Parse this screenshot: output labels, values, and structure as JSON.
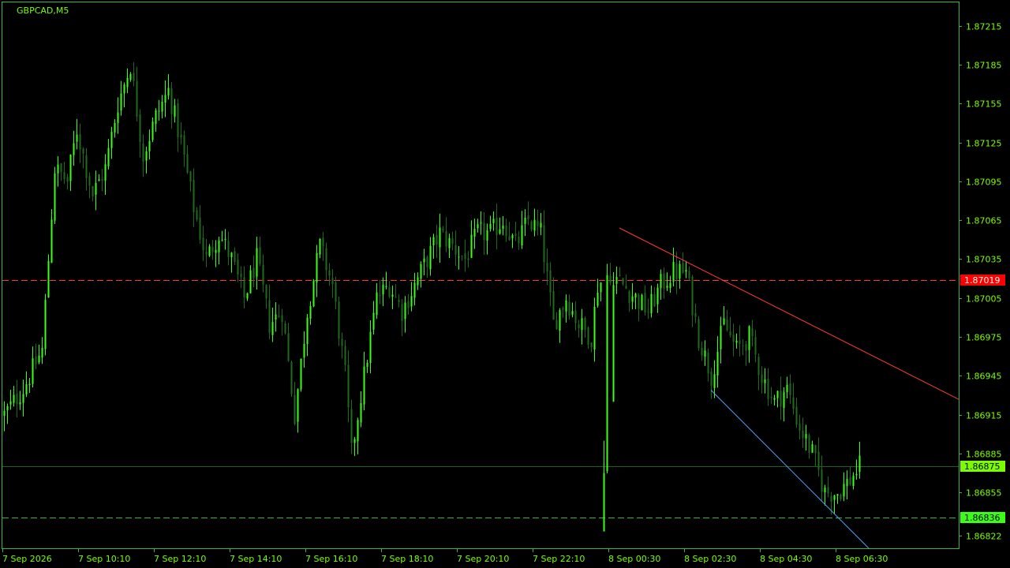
{
  "window": {
    "symbol_label": "GBPCAD,M5"
  },
  "chart_data": {
    "type": "candlestick",
    "symbol": "GBPCAD",
    "timeframe": "M5",
    "ylim": [
      1.86812,
      1.87233
    ],
    "y_ticks": [
      "1.87215",
      "1.87185",
      "1.87155",
      "1.87125",
      "1.87095",
      "1.87065",
      "1.87035",
      "1.87005",
      "1.86975",
      "1.86945",
      "1.86915",
      "1.86885",
      "1.86855",
      "1.86822"
    ],
    "x_ticks": [
      {
        "bar": 0,
        "label": "7 Sep 2026"
      },
      {
        "bar": 24,
        "label": "7 Sep 10:10"
      },
      {
        "bar": 48,
        "label": "7 Sep 12:10"
      },
      {
        "bar": 72,
        "label": "7 Sep 14:10"
      },
      {
        "bar": 96,
        "label": "7 Sep 16:10"
      },
      {
        "bar": 120,
        "label": "7 Sep 18:10"
      },
      {
        "bar": 144,
        "label": "7 Sep 20:10"
      },
      {
        "bar": 168,
        "label": "7 Sep 22:10"
      },
      {
        "bar": 192,
        "label": "8 Sep 00:30"
      },
      {
        "bar": 216,
        "label": "8 Sep 02:30"
      },
      {
        "bar": 240,
        "label": "8 Sep 04:30"
      },
      {
        "bar": 264,
        "label": "8 Sep 06:30"
      }
    ],
    "bar_count": 272,
    "close_anchors": [
      [
        0,
        1.86915
      ],
      [
        6,
        1.86935
      ],
      [
        12,
        1.86965
      ],
      [
        14,
        1.87035
      ],
      [
        16,
        1.87105
      ],
      [
        20,
        1.87095
      ],
      [
        23,
        1.87135
      ],
      [
        28,
        1.87085
      ],
      [
        32,
        1.87105
      ],
      [
        36,
        1.87155
      ],
      [
        40,
        1.87185
      ],
      [
        44,
        1.87115
      ],
      [
        48,
        1.87145
      ],
      [
        52,
        1.87165
      ],
      [
        56,
        1.87125
      ],
      [
        60,
        1.87075
      ],
      [
        64,
        1.87035
      ],
      [
        68,
        1.87055
      ],
      [
        72,
        1.87035
      ],
      [
        76,
        1.87005
      ],
      [
        80,
        1.87035
      ],
      [
        84,
        1.86985
      ],
      [
        88,
        1.86995
      ],
      [
        92,
        1.86915
      ],
      [
        96,
        1.86995
      ],
      [
        100,
        1.87045
      ],
      [
        104,
        1.87015
      ],
      [
        108,
        1.86945
      ],
      [
        110,
        1.86885
      ],
      [
        114,
        1.86945
      ],
      [
        118,
        1.87005
      ],
      [
        122,
        1.87015
      ],
      [
        126,
        1.86995
      ],
      [
        130,
        1.87015
      ],
      [
        134,
        1.87035
      ],
      [
        138,
        1.87055
      ],
      [
        142,
        1.87045
      ],
      [
        146,
        1.87035
      ],
      [
        150,
        1.87055
      ],
      [
        154,
        1.87055
      ],
      [
        158,
        1.87065
      ],
      [
        162,
        1.87045
      ],
      [
        166,
        1.87065
      ],
      [
        170,
        1.87055
      ],
      [
        174,
        1.86985
      ],
      [
        178,
        1.87005
      ],
      [
        182,
        1.86985
      ],
      [
        186,
        1.86975
      ],
      [
        188,
        1.87015
      ],
      [
        192,
        1.87025
      ],
      [
        196,
        1.87015
      ],
      [
        200,
        1.87005
      ],
      [
        204,
        1.86995
      ],
      [
        208,
        1.87015
      ],
      [
        212,
        1.87025
      ],
      [
        216,
        1.87025
      ],
      [
        220,
        1.86975
      ],
      [
        224,
        1.86945
      ],
      [
        228,
        1.86985
      ],
      [
        232,
        1.86965
      ],
      [
        236,
        1.86975
      ],
      [
        240,
        1.86945
      ],
      [
        244,
        1.86925
      ],
      [
        248,
        1.86935
      ],
      [
        252,
        1.86905
      ],
      [
        256,
        1.86885
      ],
      [
        260,
        1.86855
      ],
      [
        264,
        1.86855
      ],
      [
        268,
        1.86865
      ],
      [
        271,
        1.86875
      ]
    ],
    "events": [
      {
        "bar": 190,
        "low": 1.86825,
        "high": 1.86895,
        "open": 1.86825,
        "close": 1.8687
      },
      {
        "bar": 193,
        "low": 1.86925,
        "high": 1.87025,
        "open": 1.86925,
        "close": 1.87015
      }
    ],
    "levels": [
      {
        "name": "resistance-level",
        "price": 1.87019,
        "label": "1.87019",
        "color": "#FF3B30",
        "dash": true
      },
      {
        "name": "current-bid",
        "price": 1.86875,
        "label": "1.86875",
        "color": "#1F5F1F",
        "dash": false
      },
      {
        "name": "support-level",
        "price": 1.86836,
        "label": "1.86836",
        "color": "#39B54A",
        "dash": true
      }
    ],
    "trendlines": [
      {
        "name": "resistance-trendline",
        "color": "#FF3B30",
        "from": {
          "bar": 195,
          "price": 1.87059
        },
        "to": {
          "bar": 304,
          "price": 1.86925
        }
      },
      {
        "name": "support-trendline",
        "color": "#4FA3FF",
        "from": {
          "bar": 224,
          "price": 1.86934
        },
        "to": {
          "bar": 274,
          "price": 1.86812
        }
      }
    ],
    "colors": {
      "background": "#000000",
      "axis": "#39B54A",
      "text": "#7CFC00",
      "bull_candle": "#39FF14",
      "bear_candle": "#1E6B1E",
      "price_tag_current": "#7CFC00",
      "price_tag_support": "#39FF14",
      "price_tag_resistance": "#FF0000"
    }
  }
}
